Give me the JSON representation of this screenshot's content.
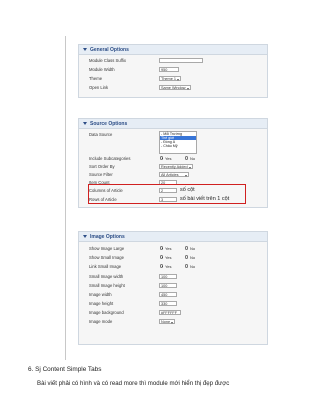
{
  "general": {
    "title": "General Options",
    "module_class_suffix_label": "Module Class Suffix",
    "module_width_label": "Module Width",
    "module_width_value": "950",
    "theme_label": "Theme",
    "theme_value": "Theme 1",
    "open_link_label": "Open Link",
    "open_link_value": "Same Window"
  },
  "source": {
    "title": "Source Options",
    "data_source_label": "Data Source",
    "data_source_options": [
      "- Mỗi Trường",
      "Thế giới",
      "- Đồng Á",
      "- Châu Mỹ"
    ],
    "include_subcategories_label": "Include Subcategories",
    "yes_label": "Yes",
    "no_label": "No",
    "sort_order_label": "Sort Order By",
    "sort_order_value": "Recently Added",
    "source_filter_label": "Source Filter",
    "source_filter_value": "All Articles",
    "item_count_label": "Item Count",
    "item_count_value": "20",
    "columns_label": "Columns of Article",
    "columns_value": "2",
    "columns_note": "số cột",
    "rows_label": "Rows of Article",
    "rows_value": "3",
    "rows_note": "số bài viết trên 1 cột"
  },
  "image": {
    "title": "Image Options",
    "show_large_label": "Show Image Large",
    "show_small_label": "Show Small Image",
    "link_small_label": "Link Small Image",
    "yes_label": "Yes",
    "no_label": "No",
    "small_width_label": "Small Image width",
    "small_width_value": "100",
    "small_height_label": "Small Image height",
    "small_height_value": "100",
    "width_label": "Image width",
    "width_value": "450",
    "height_label": "Image height",
    "height_value": "330",
    "background_label": "Image background",
    "background_value": "#FFFFFF",
    "mode_label": "Image mode",
    "mode_value": "None"
  },
  "doc": {
    "heading": "6. Sj Content Simple Tabs",
    "paragraph": "Bài viết phải có hình và có read more thì module mới hiển thị đẹp được"
  },
  "colors": {
    "header_text": "#2c4d86",
    "highlight": "#3875d7",
    "annotation_border": "#d02020"
  }
}
